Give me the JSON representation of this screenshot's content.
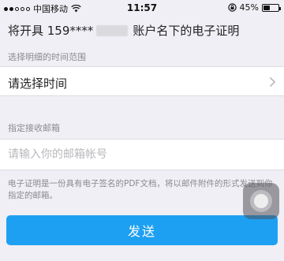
{
  "status_bar": {
    "carrier": "中国移动",
    "time": "11:57",
    "battery": "45%",
    "battery_level": 0.45,
    "icons": [
      "signal-dots-icon",
      "wifi-icon",
      "lock-rotation-icon",
      "battery-icon"
    ]
  },
  "header": {
    "title_prefix": "将开具 159****",
    "title_suffix": "账户名下的电子证明"
  },
  "time_section": {
    "label": "选择明细的时间范围",
    "value": "请选择时间"
  },
  "email_section": {
    "label": "指定接收邮箱",
    "placeholder": "请输入你的邮箱帐号",
    "value": ""
  },
  "note": "电子证明是一份具有电子签名的PDF文档，将以邮件附件的形式发送到你指定的邮箱。",
  "send_button": "发送",
  "colors": {
    "accent": "#1ea0f2",
    "background": "#f0eff5"
  }
}
